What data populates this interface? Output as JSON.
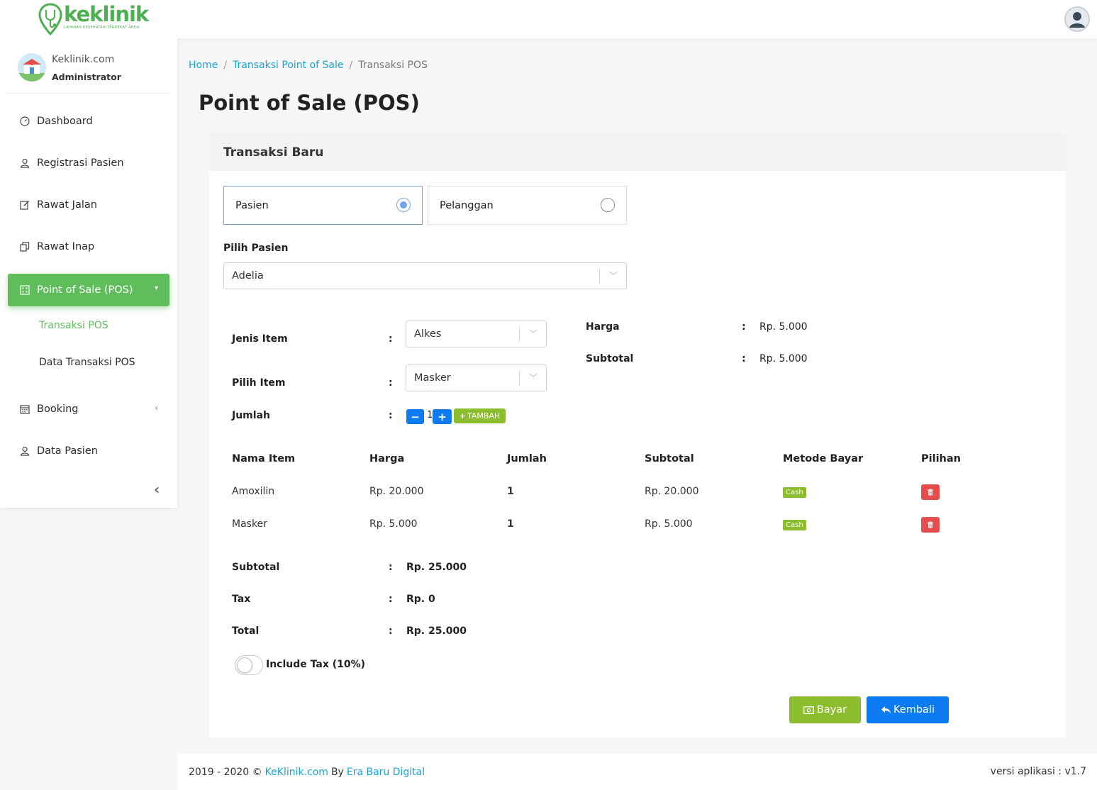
{
  "header": {
    "brand": "keklinik",
    "tagline": "LAYANAN KESEHATAN TERDEKAT ANDA"
  },
  "sidebar": {
    "profile_name": "Keklinik.com",
    "profile_role": "Administrator",
    "items": [
      {
        "label": "Dashboard",
        "icon": "dashboard-icon"
      },
      {
        "label": "Registrasi Pasien",
        "icon": "user-icon"
      },
      {
        "label": "Rawat Jalan",
        "icon": "edit-icon"
      },
      {
        "label": "Rawat Inap",
        "icon": "copy-icon"
      },
      {
        "label": "Point of Sale (POS)",
        "icon": "pos-icon"
      },
      {
        "label": "Booking",
        "icon": "calendar-icon"
      },
      {
        "label": "Data Pasien",
        "icon": "user-icon"
      }
    ],
    "subitems": [
      "Transaksi POS",
      "Data Transaksi POS"
    ]
  },
  "breadcrumb": [
    "Home",
    "Transaksi Point of Sale",
    "Transaksi POS"
  ],
  "page_title": "Point of Sale (POS)",
  "card_title": "Transaksi Baru",
  "customer_type": {
    "options": [
      "Pasien",
      "Pelanggan"
    ],
    "selected": "Pasien"
  },
  "patient": {
    "label": "Pilih Pasien",
    "value": "Adelia"
  },
  "form": {
    "jenis_label": "Jenis Item",
    "jenis_value": "Alkes",
    "item_label": "Pilih Item",
    "item_value": "Masker",
    "jumlah_label": "Jumlah",
    "jumlah_value": "1",
    "tambah_label": "TAMBAH",
    "harga_label": "Harga",
    "harga_value": "Rp. 5.000",
    "subtotal_label": "Subtotal",
    "subtotal_value": "Rp. 5.000"
  },
  "table": {
    "headers": [
      "Nama Item",
      "Harga",
      "Jumlah",
      "Subtotal",
      "Metode Bayar",
      "Pilihan"
    ],
    "rows": [
      {
        "nama": "Amoxilin",
        "harga": "Rp. 20.000",
        "jumlah": "1",
        "subtotal": "Rp. 20.000",
        "metode": "Cash"
      },
      {
        "nama": "Masker",
        "harga": "Rp. 5.000",
        "jumlah": "1",
        "subtotal": "Rp. 5.000",
        "metode": "Cash"
      }
    ]
  },
  "summary": {
    "subtotal_label": "Subtotal",
    "subtotal_value": "Rp. 25.000",
    "tax_label": "Tax",
    "tax_value": "Rp. 0",
    "total_label": "Total",
    "total_value": "Rp. 25.000",
    "include_tax_label": "Include Tax (10%)"
  },
  "actions": {
    "bayar": "Bayar",
    "kembali": "Kembali"
  },
  "footer": {
    "years": "2019 - 2020 ©",
    "site": "KeKlinik.com",
    "by": "By",
    "company": "Era Baru Digital",
    "version": "versi aplikasi : v1.7"
  },
  "colors": {
    "primary_green": "#5fbd5b",
    "accent_green": "#8bbd2f",
    "blue": "#0d7cf2",
    "link": "#1aa3d6",
    "danger": "#e74c4c"
  }
}
